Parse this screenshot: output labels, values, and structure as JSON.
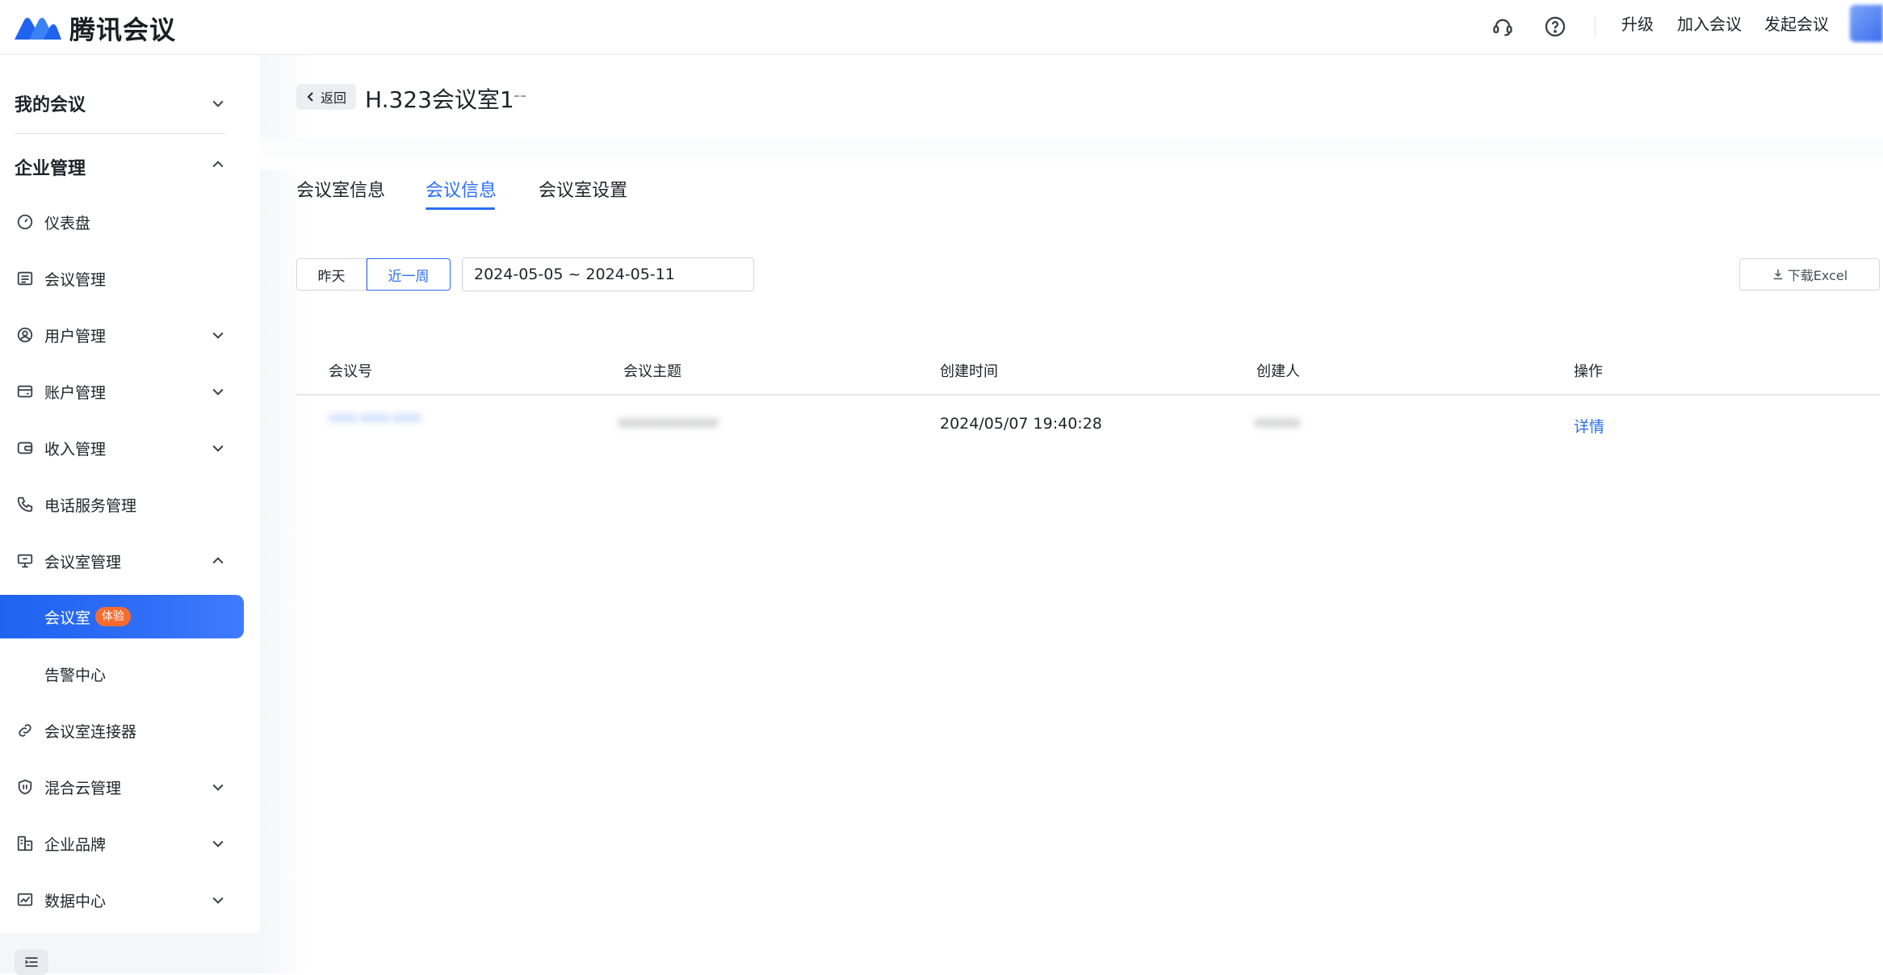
{
  "app": {
    "name": "腾讯会议"
  },
  "topbar": {
    "links": [
      "升级",
      "加入会议",
      "发起会议"
    ]
  },
  "sidebar": {
    "sections": [
      {
        "label": "我的会议",
        "expanded": false
      },
      {
        "label": "企业管理",
        "expanded": true
      }
    ],
    "items": [
      {
        "label": "仪表盘",
        "icon": "dashboard-icon",
        "has_chevron": false
      },
      {
        "label": "会议管理",
        "icon": "list-icon",
        "has_chevron": false
      },
      {
        "label": "用户管理",
        "icon": "user-icon",
        "has_chevron": true
      },
      {
        "label": "账户管理",
        "icon": "wallet-icon",
        "has_chevron": true
      },
      {
        "label": "收入管理",
        "icon": "income-icon",
        "has_chevron": true
      },
      {
        "label": "电话服务管理",
        "icon": "phone-icon",
        "has_chevron": false
      },
      {
        "label": "会议室管理",
        "icon": "room-icon",
        "has_chevron": true,
        "expanded": true
      },
      {
        "label": "会议室",
        "badge": "体验",
        "active": true
      },
      {
        "label": "告警中心"
      },
      {
        "label": "会议室连接器",
        "icon": "link-icon",
        "has_chevron": false
      },
      {
        "label": "混合云管理",
        "icon": "cloud-icon",
        "has_chevron": true
      },
      {
        "label": "企业品牌",
        "icon": "brand-icon",
        "has_chevron": true
      },
      {
        "label": "数据中心",
        "icon": "chart-icon",
        "has_chevron": true
      }
    ]
  },
  "header": {
    "back_label": "返回",
    "title": "H.323会议室1",
    "subtitle": "--"
  },
  "tabs": [
    {
      "label": "会议室信息",
      "active": false
    },
    {
      "label": "会议信息",
      "active": true
    },
    {
      "label": "会议室设置",
      "active": false
    }
  ],
  "filters": {
    "range_options": [
      "昨天",
      "近一周"
    ],
    "selected_range": "近一周",
    "date_range": "2024-05-05 ~ 2024-05-11",
    "download_label": "下载Excel"
  },
  "table": {
    "columns": [
      "会议号",
      "会议主题",
      "创建时间",
      "创建人",
      "操作"
    ],
    "rows": [
      {
        "meeting_id": "•••-•••-•••",
        "topic": "•••••••••••",
        "created_time": "2024/05/07 19:40:28",
        "creator": "•••••",
        "action": "详情"
      }
    ]
  },
  "colors": {
    "accent": "#2b6ef5",
    "badge": "#f86b2e"
  }
}
